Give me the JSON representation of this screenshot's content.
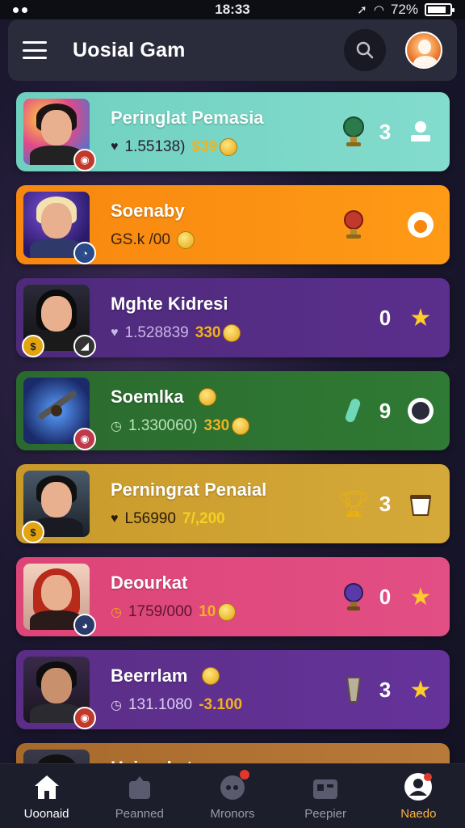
{
  "status": {
    "time": "18:33",
    "battery": "72%"
  },
  "header": {
    "title": "Uosial Gam"
  },
  "players": [
    {
      "name": "Peringlat Pemasia",
      "stats": "1.55138)",
      "gold": "$39",
      "count": "3",
      "theme": "c1"
    },
    {
      "name": "Soenaby",
      "stats": "GS.k /00",
      "gold": "",
      "count": "",
      "theme": "c2"
    },
    {
      "name": "Mghte Kidresi",
      "stats": "1.528839",
      "gold": "330",
      "count": "0",
      "theme": "c3"
    },
    {
      "name": "Soemlka",
      "stats": "1.330060)",
      "gold": "330",
      "count": "9",
      "theme": "c4"
    },
    {
      "name": "Perningrat Penaial",
      "stats": "L56990",
      "gold": "7/,200",
      "count": "3",
      "theme": "c5"
    },
    {
      "name": "Deourkat",
      "stats": "1759/000",
      "gold": "10",
      "count": "0",
      "theme": "c6"
    },
    {
      "name": "Beerrlam",
      "stats": "131.1080",
      "gold": "-3.100",
      "count": "3",
      "theme": "c7"
    },
    {
      "name": "Heiurnkat",
      "stats": "",
      "gold": "",
      "count": "",
      "theme": "c8"
    }
  ],
  "nav": [
    {
      "label": "Uoonaid"
    },
    {
      "label": "Peanned"
    },
    {
      "label": "Mronors"
    },
    {
      "label": "Peepier"
    },
    {
      "label": "Naedo"
    }
  ]
}
